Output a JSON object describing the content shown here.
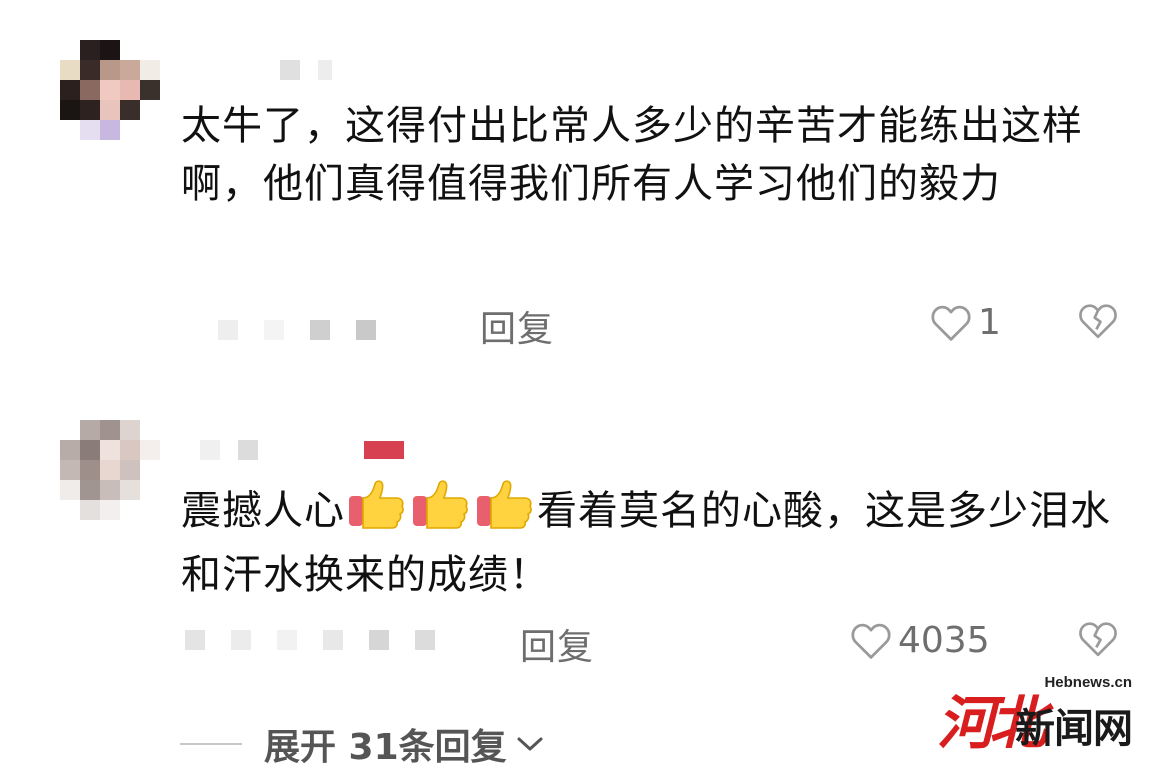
{
  "comments": [
    {
      "text": "太牛了，这得付出比常人多少的辛苦才能练出这样啊，他们真得值得我们所有人学习他们的毅力",
      "reply_label": "回复",
      "like_count": "1"
    },
    {
      "text_before": "震撼人心",
      "emoji_icons": [
        "thumbs-up-icon",
        "thumbs-up-icon",
        "thumbs-up-icon"
      ],
      "text_after": "看着莫名的心酸，这是多少泪水和汗水换来的成绩！",
      "reply_label": "回复",
      "like_count": "4035"
    }
  ],
  "expand_label": "展开 31条回复",
  "watermark": {
    "site": "Hebnews.cn",
    "logo": "河北",
    "name": "新闻网"
  },
  "colors": {
    "accent_red": "#d81e1e",
    "secondary_text": "#6e6e6e"
  }
}
